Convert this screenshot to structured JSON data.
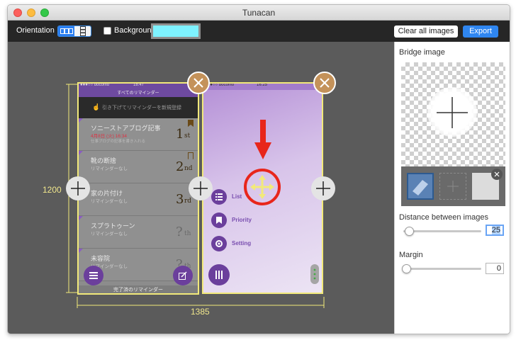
{
  "window": {
    "title": "Tunacan"
  },
  "toolbar": {
    "orientation_label": "Orientation",
    "background_label": "Background",
    "background_color": "#7ef2ff",
    "clear_label": "Clear all images",
    "export_label": "Export"
  },
  "canvas": {
    "height_label": "1200",
    "width_label": "1385"
  },
  "phone_left": {
    "status_carrier": "●●●○○ docomo",
    "status_time": "18:47",
    "header_title": "すべてのリマインダー",
    "pull_hint": "引き下げてリマインダーを新規登録",
    "items": [
      {
        "title": "ソニーストアブログ記事",
        "sub1": "4月8日 (火) 16:34",
        "sub2": "仕事ブログの記事を書き入れる",
        "rank": "1",
        "suffix": "st"
      },
      {
        "title": "靴の断捨",
        "sub1": "リマインダーなし",
        "sub2": "",
        "rank": "2",
        "suffix": "nd"
      },
      {
        "title": "家の片付け",
        "sub1": "リマインダーなし",
        "sub2": "",
        "rank": "3",
        "suffix": "rd"
      },
      {
        "title": "スプラトゥーン",
        "sub1": "リマインダーなし",
        "sub2": "",
        "rank": "?",
        "suffix": "th"
      },
      {
        "title": "未容院",
        "sub1": "リマインダーなし",
        "sub2": "",
        "rank": "?",
        "suffix": "th"
      }
    ],
    "footer": "完了済のリマインダー"
  },
  "phone_right": {
    "status_carrier": "●●●○○ docomo",
    "status_time": "16:25",
    "menu": [
      {
        "label": "List",
        "icon": "list-icon"
      },
      {
        "label": "Priority",
        "icon": "bookmark-icon"
      },
      {
        "label": "Setting",
        "icon": "gear-icon"
      }
    ]
  },
  "side": {
    "bridge_label": "Bridge image",
    "distance_label": "Distance between images",
    "distance_value": "25",
    "distance_fraction": 0.04,
    "margin_label": "Margin",
    "margin_value": "0",
    "margin_fraction": 0
  },
  "colors": {
    "accent": "#2f86f0",
    "frame": "#f2e97a",
    "phone_purple": "#8a5cc2",
    "annotation_red": "#e8261b"
  }
}
